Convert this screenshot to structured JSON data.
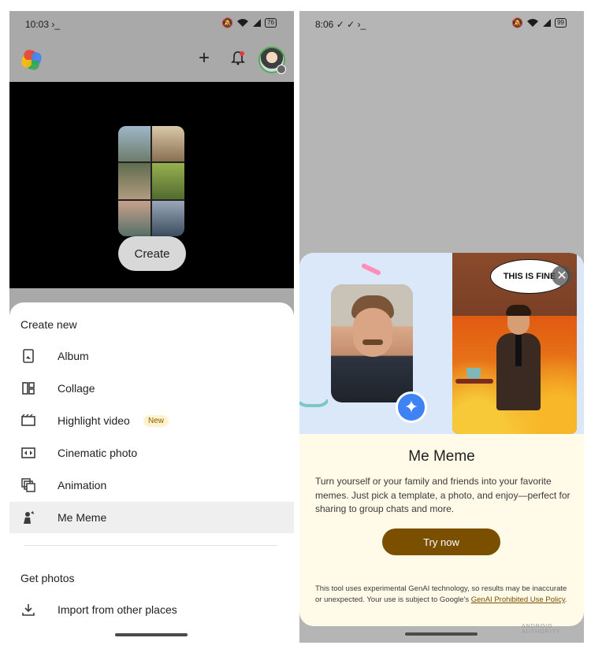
{
  "left": {
    "status": {
      "time": "10:03 ›_",
      "battery": "76"
    },
    "create_button": "Create",
    "sheet": {
      "section_create": "Create new",
      "items": [
        {
          "label": "Album",
          "icon": "album-icon"
        },
        {
          "label": "Collage",
          "icon": "collage-icon"
        },
        {
          "label": "Highlight video",
          "icon": "highlight-video-icon",
          "badge": "New"
        },
        {
          "label": "Cinematic photo",
          "icon": "cinematic-photo-icon"
        },
        {
          "label": "Animation",
          "icon": "animation-icon"
        },
        {
          "label": "Me Meme",
          "icon": "me-meme-icon"
        }
      ],
      "section_get": "Get photos",
      "import_label": "Import from other places"
    }
  },
  "right": {
    "status": {
      "time": "8:06 ✓ ✓ ›_",
      "battery": "99"
    },
    "meme_bubble": "THIS IS FINE",
    "title": "Me Meme",
    "description": "Turn yourself or your family and friends into your favorite memes. Just pick a template, a photo, and enjoy—perfect for sharing to group chats and more.",
    "try_button": "Try now",
    "disclaimer_text": "This tool uses experimental GenAI technology, so results may be inaccurate or unexpected. Your use is subject to Google's ",
    "disclaimer_link": "GenAI Prohibited Use Policy",
    "disclaimer_end": "."
  },
  "watermark": "ANDROID AUTHORITY",
  "colors": {
    "accent_brown": "#7a4f00",
    "sheet_bg": "#ffffff",
    "dialog_bg": "#fffbe8",
    "hero_bg": "#dbe8f9",
    "sparkle_blue": "#3e82f4"
  }
}
